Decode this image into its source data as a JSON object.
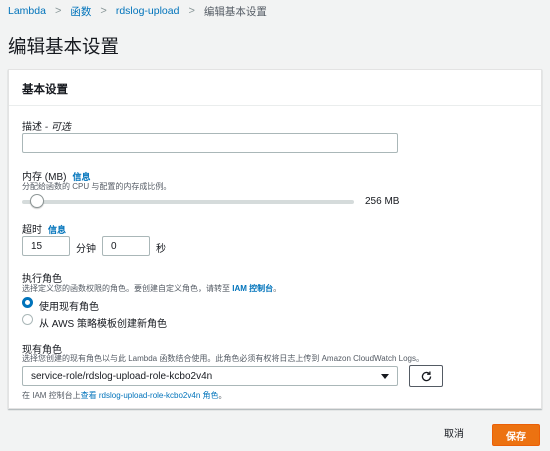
{
  "breadcrumb": {
    "items": [
      "Lambda",
      "函数",
      "rdslog-upload"
    ],
    "current": "编辑基本设置",
    "separator": ">"
  },
  "page_title": "编辑基本设置",
  "panel": {
    "title": "基本设置",
    "description": {
      "label": "描述",
      "optional": "- 可选",
      "value": ""
    },
    "memory": {
      "label": "内存 (MB)",
      "info": "信息",
      "help": "分配给函数的 CPU 与配置的内存成比例。",
      "value_label": "256 MB",
      "value_mb": 256,
      "slider_fraction": 0.045
    },
    "timeout": {
      "label": "超时",
      "info": "信息",
      "minutes_value": "15",
      "minutes_unit": "分钟",
      "seconds_value": "0",
      "seconds_unit": "秒"
    },
    "execution_role": {
      "label": "执行角色",
      "help_prefix": "选择定义您的函数权限的角色。要创建自定义角色，请转至 ",
      "help_link": "IAM 控制台",
      "help_suffix": "。",
      "options": [
        {
          "label": "使用现有角色",
          "checked": true
        },
        {
          "label": "从 AWS 策略模板创建新角色",
          "checked": false
        }
      ]
    },
    "existing_role": {
      "label": "现有角色",
      "help": "选择您创建的现有角色以与此 Lambda 函数结合使用。此角色必须有权将日志上传到 Amazon CloudWatch Logs。",
      "selected": "service-role/rdslog-upload-role-kcbo2v4n",
      "footer_prefix": "在 IAM 控制台上",
      "footer_link": "查看 rdslog-upload-role-kcbo2v4n 角色",
      "footer_suffix": "。"
    }
  },
  "footer": {
    "cancel_label": "取消",
    "save_label": "保存"
  },
  "colors": {
    "link": "#0073bb",
    "primary_button": "#ec7211",
    "background": "#f2f3f3"
  }
}
